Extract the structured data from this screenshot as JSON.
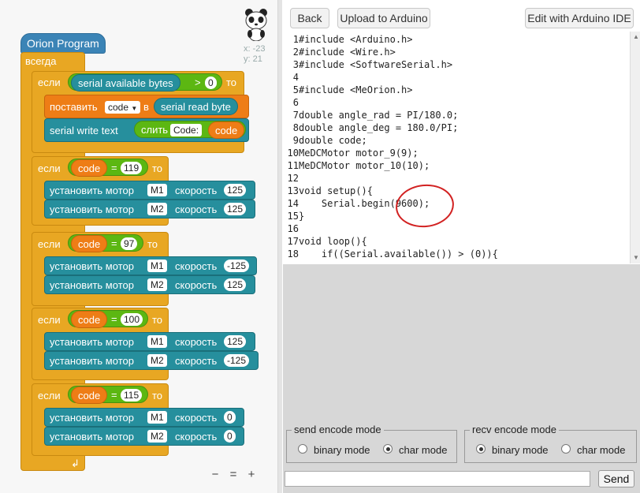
{
  "toolbar": {
    "back_label": "Back",
    "upload_label": "Upload to Arduino",
    "edit_label": "Edit with Arduino IDE"
  },
  "stage": {
    "coord_x": "x: -23",
    "coord_y": "y: 21",
    "mascot_icon": "panda-icon"
  },
  "program": {
    "hat_label": "Orion Program",
    "forever_label": "всегда",
    "if_label": "если",
    "then_label": "то",
    "block1": {
      "condition_reporter": "serial available bytes",
      "operator": ">",
      "operand": "0",
      "set_label": "поставить",
      "set_var": "code",
      "in_label": "в",
      "set_value": "serial read byte",
      "write_label": "serial write text",
      "join_label": "слить",
      "join_text": "Code:",
      "join_var": "code"
    },
    "motor_label": "установить мотор",
    "speed_label": "скорость",
    "cond_var": "code",
    "eq": "=",
    "branches": [
      {
        "value": "119",
        "m1": "M1",
        "m1_speed": "125",
        "m2": "M2",
        "m2_speed": "125"
      },
      {
        "value": "97",
        "m1": "M1",
        "m1_speed": "-125",
        "m2": "M2",
        "m2_speed": "125"
      },
      {
        "value": "100",
        "m1": "M1",
        "m1_speed": "125",
        "m2": "M2",
        "m2_speed": "-125"
      },
      {
        "value": "115",
        "m1": "M1",
        "m1_speed": "0",
        "m2": "M2",
        "m2_speed": "0"
      }
    ],
    "loop_arrow": "↲"
  },
  "zoom": {
    "out": "−",
    "reset": "=",
    "in": "+"
  },
  "code": {
    "lines": [
      {
        "n": "1",
        "text": "#include <Arduino.h>"
      },
      {
        "n": "2",
        "text": "#include <Wire.h>"
      },
      {
        "n": "3",
        "text": "#include <SoftwareSerial.h>"
      },
      {
        "n": "4",
        "text": ""
      },
      {
        "n": "5",
        "text": "#include <MeOrion.h>"
      },
      {
        "n": "6",
        "text": ""
      },
      {
        "n": "7",
        "text": "double angle_rad = PI/180.0;"
      },
      {
        "n": "8",
        "text": "double angle_deg = 180.0/PI;"
      },
      {
        "n": "9",
        "text": "double code;"
      },
      {
        "n": "10",
        "text": "MeDCMotor motor_9(9);"
      },
      {
        "n": "11",
        "text": "MeDCMotor motor_10(10);"
      },
      {
        "n": "12",
        "text": ""
      },
      {
        "n": "13",
        "text": "void setup(){"
      },
      {
        "n": "14",
        "text": "    Serial.begin(9600);"
      },
      {
        "n": "15",
        "text": "}"
      },
      {
        "n": "16",
        "text": ""
      },
      {
        "n": "17",
        "text": "void loop(){"
      },
      {
        "n": "18",
        "text": "    if((Serial.available()) > (0)){"
      }
    ]
  },
  "serial": {
    "send_mode_title": "send encode mode",
    "recv_mode_title": "recv encode mode",
    "binary_label": "binary mode",
    "char_label": "char mode",
    "send_selected": "char mode",
    "recv_selected": "binary mode",
    "input_value": "",
    "send_label": "Send"
  }
}
